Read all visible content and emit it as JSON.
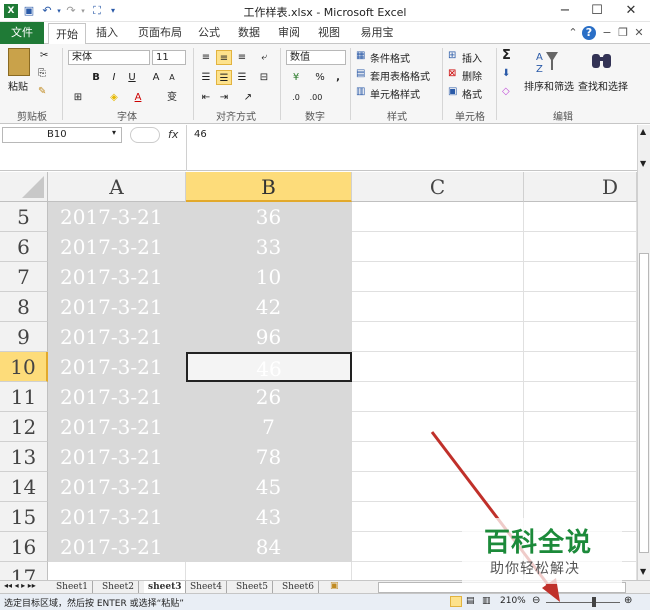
{
  "window": {
    "title": "工作样表.xlsx - Microsoft Excel",
    "controls": {
      "minimize": "−",
      "maximize": "☐",
      "close": "✕"
    }
  },
  "tabs": [
    {
      "label": "文件",
      "kind": "file"
    },
    {
      "label": "开始",
      "kind": "active"
    },
    {
      "label": "插入"
    },
    {
      "label": "页面布局"
    },
    {
      "label": "公式"
    },
    {
      "label": "数据"
    },
    {
      "label": "审阅"
    },
    {
      "label": "视图"
    },
    {
      "label": "易用宝"
    }
  ],
  "ribbon": {
    "clipboard": {
      "label": "剪贴板",
      "paste": "粘贴"
    },
    "font": {
      "label": "字体",
      "name": "宋体",
      "size": "11",
      "bold": "B",
      "italic": "I",
      "underline": "U",
      "grow": "A",
      "shrink": "A",
      "color": "A",
      "phonetic": "变"
    },
    "alignment": {
      "label": "对齐方式"
    },
    "number": {
      "label": "数字",
      "format": "数值",
      "percent": "%",
      "comma": ","
    },
    "styles": {
      "label": "样式",
      "conditional": "条件格式",
      "table": "套用表格格式",
      "cell": "单元格样式"
    },
    "cells": {
      "label": "单元格",
      "insert": "插入",
      "delete": "删除",
      "format": "格式"
    },
    "editing": {
      "label": "编辑",
      "sum": "Σ",
      "sort": "排序和筛选",
      "find": "查找和选择"
    }
  },
  "formula_bar": {
    "name_box": "B10",
    "fx": "fx",
    "value": "46"
  },
  "columns": [
    "A",
    "B",
    "C",
    "D"
  ],
  "rows": [
    {
      "num": "5",
      "a": "2017-3-21",
      "b": "36"
    },
    {
      "num": "6",
      "a": "2017-3-21",
      "b": "33"
    },
    {
      "num": "7",
      "a": "2017-3-21",
      "b": "10"
    },
    {
      "num": "8",
      "a": "2017-3-21",
      "b": "42"
    },
    {
      "num": "9",
      "a": "2017-3-21",
      "b": "96"
    },
    {
      "num": "10",
      "a": "2017-3-21",
      "b": "46"
    },
    {
      "num": "11",
      "a": "2017-3-21",
      "b": "26"
    },
    {
      "num": "12",
      "a": "2017-3-21",
      "b": "7"
    },
    {
      "num": "13",
      "a": "2017-3-21",
      "b": "78"
    },
    {
      "num": "14",
      "a": "2017-3-21",
      "b": "45"
    },
    {
      "num": "15",
      "a": "2017-3-21",
      "b": "43"
    },
    {
      "num": "16",
      "a": "2017-3-21",
      "b": "84"
    },
    {
      "num": "17",
      "a": "",
      "b": ""
    }
  ],
  "selected_cell": "B10",
  "sheet_tabs": [
    "Sheet1",
    "Sheet2",
    "sheet3",
    "Sheet4",
    "Sheet5",
    "Sheet6"
  ],
  "active_sheet": "sheet3",
  "status": {
    "message": "选定目标区域，然后按 ENTER 或选择“粘贴”",
    "zoom": "210%"
  },
  "watermark": {
    "brand": "百科全说",
    "slogan": "助你轻松解决"
  },
  "colors": {
    "file_tab": "#1f7a36",
    "selection_header": "#fddc7a",
    "selected_range": "#d9d9d9",
    "watermark": "#1c8a3a",
    "arrow": "#c0302a"
  }
}
